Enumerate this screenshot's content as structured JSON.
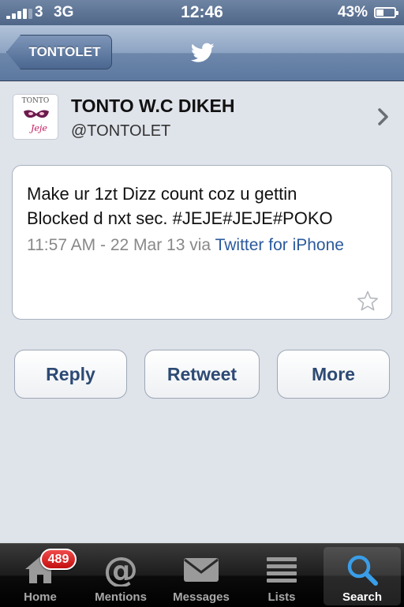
{
  "status_bar": {
    "carrier": "3",
    "network": "3G",
    "time": "12:46",
    "battery": "43%",
    "battery_level": 0.43
  },
  "nav": {
    "back_label": "TONTOLET",
    "center_icon": "twitter-bird-icon"
  },
  "profile": {
    "name": "TONTO W.C DIKEH",
    "handle": "@TONTOLET",
    "avatar_top_text": "TONTO",
    "avatar_sig_text": "Jeje"
  },
  "tweet": {
    "text": "Make ur 1zt Dizz count coz u gettin Blocked d nxt sec. #JEJE#JEJE#POKO",
    "timestamp": "11:57 AM - 22 Mar 13",
    "via_word": "via",
    "source": "Twitter for iPhone"
  },
  "actions": {
    "reply": "Reply",
    "retweet": "Retweet",
    "more": "More"
  },
  "tab_bar": {
    "home": "Home",
    "home_badge": "489",
    "mentions": "Mentions",
    "messages": "Messages",
    "lists": "Lists",
    "search": "Search"
  },
  "colors": {
    "nav_blue": "#6d87ab",
    "link_blue": "#2b5a9c",
    "badge_red": "#d8201f"
  }
}
